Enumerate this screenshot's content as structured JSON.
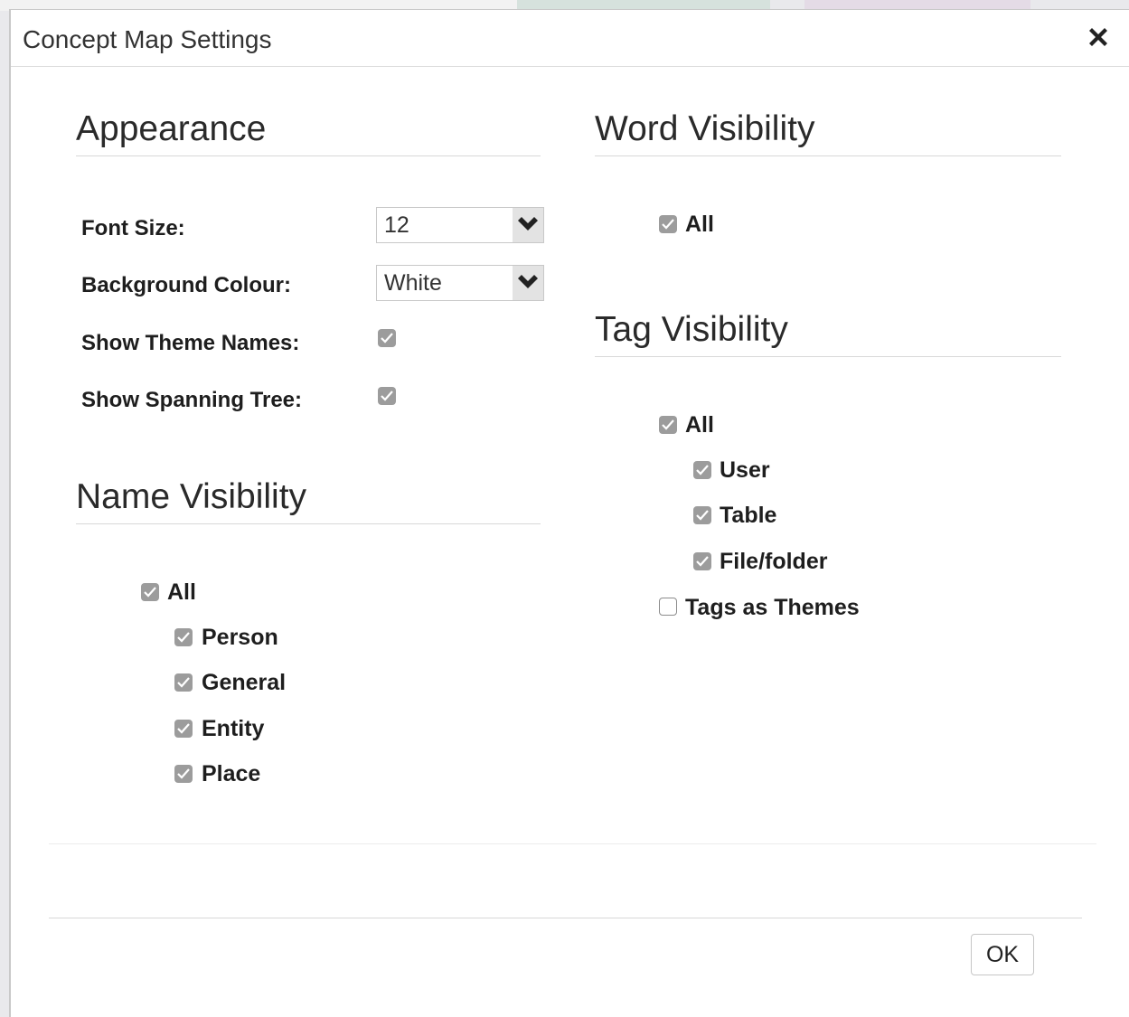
{
  "dialog": {
    "title": "Concept Map Settings",
    "close_icon": "close-icon",
    "ok_label": "OK"
  },
  "appearance": {
    "heading": "Appearance",
    "font_size_label": "Font Size:",
    "font_size_value": "12",
    "background_label": "Background Colour:",
    "background_value": "White",
    "show_theme_names_label": "Show Theme Names:",
    "show_theme_names_checked": true,
    "show_spanning_tree_label": "Show Spanning Tree:",
    "show_spanning_tree_checked": true
  },
  "name_visibility": {
    "heading": "Name Visibility",
    "all_label": "All",
    "items": [
      {
        "label": "Person",
        "checked": true
      },
      {
        "label": "General",
        "checked": true
      },
      {
        "label": "Entity",
        "checked": true
      },
      {
        "label": "Place",
        "checked": true
      }
    ]
  },
  "word_visibility": {
    "heading": "Word Visibility",
    "all_label": "All"
  },
  "tag_visibility": {
    "heading": "Tag Visibility",
    "all_label": "All",
    "items": [
      {
        "label": "User",
        "checked": true
      },
      {
        "label": "Table",
        "checked": true
      },
      {
        "label": "File/folder",
        "checked": true
      }
    ],
    "tags_as_themes_label": "Tags as Themes",
    "tags_as_themes_checked": false
  },
  "colors": {
    "checkbox_fill": "#9c9c9c",
    "heading_rule": "#d8d8d8"
  }
}
